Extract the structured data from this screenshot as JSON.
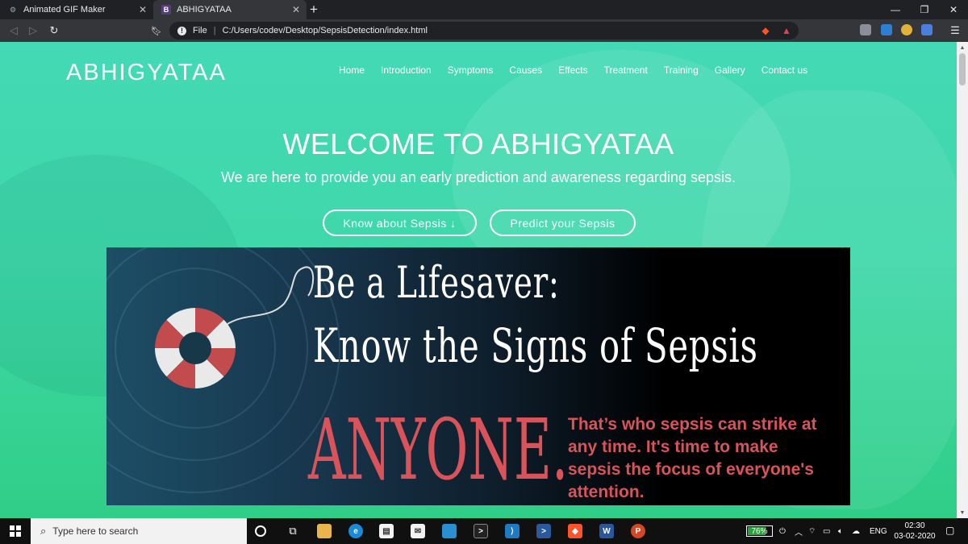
{
  "browser": {
    "tabs": [
      {
        "title": "Animated GIF Maker",
        "active": false
      },
      {
        "title": "ABHIGYATAA",
        "active": true
      }
    ],
    "new_tab": "+",
    "close_glyph": "✕",
    "omnibox": {
      "scheme_label": "File",
      "url": "C:/Users/codev/Desktop/SepsisDetection/index.html"
    }
  },
  "site": {
    "brand": "ABHIGYATAA",
    "nav": [
      "Home",
      "Introduction",
      "Symptoms",
      "Causes",
      "Effects",
      "Treatment",
      "Training",
      "Gallery",
      "Contact us"
    ],
    "hero_title": "WELCOME TO ABHIGYATAA",
    "hero_subtitle": "We are here to provide you an early prediction and awareness regarding sepsis.",
    "buttons": {
      "know": "Know about Sepsis ↓",
      "predict": "Predict your Sepsis"
    },
    "banner": {
      "line1": "Be a Lifesaver:",
      "line2": "Know the Signs of Sepsis",
      "highlight": "ANYONE.",
      "text": "That’s who sepsis can strike at any time. It's time to make sepsis the focus of everyone's attention."
    }
  },
  "taskbar": {
    "search_placeholder": "Type here to search",
    "battery": "76%",
    "battery_level": 0.76,
    "language": "ENG",
    "time": "02:30",
    "date": "03-02-2020"
  },
  "colors": {
    "accent_red": "#d9545a",
    "page_green": "#3fd8a9"
  }
}
